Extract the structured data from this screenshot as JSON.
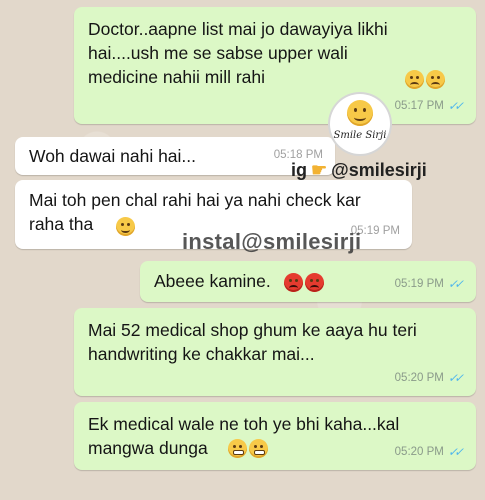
{
  "messages": [
    {
      "direction": "outgoing",
      "text": "Doctor..aapne list mai jo dawayiya likhi hai....ush me se sabse upper wali medicine nahii mill rahi",
      "emojis": [
        "sad-face-emoji",
        "sad-face-emoji"
      ],
      "time": "05:17 PM"
    },
    {
      "direction": "incoming",
      "text": "Woh dawai nahi hai...",
      "emojis": [],
      "time": "05:18 PM"
    },
    {
      "direction": "incoming",
      "text": "Mai toh pen chal rahi hai ya nahi check kar raha tha",
      "emojis": [
        "smiling-face-emoji"
      ],
      "time": "05:19 PM"
    },
    {
      "direction": "outgoing",
      "text": "Abeee kamine.",
      "emojis": [
        "angry-face-emoji",
        "angry-face-emoji"
      ],
      "time": "05:19 PM"
    },
    {
      "direction": "outgoing",
      "text": "Mai 52 medical shop ghum ke aaya hu teri handwriting ke chakkar mai...",
      "emojis": [],
      "time": "05:20 PM"
    },
    {
      "direction": "outgoing",
      "text": "Ek medical wale ne toh ye bhi kaha...kal mangwa dunga",
      "emojis": [
        "steam-face-emoji",
        "steam-face-emoji"
      ],
      "time": "05:20 PM"
    }
  ],
  "read_ticks": "✓✓",
  "watermarks": {
    "logo_text": "Smile Sirji",
    "ig_handle": "ig",
    "ig_handle_name": "@smilesirji",
    "instagram": "instal@smilesirji"
  },
  "colors": {
    "outgoing_bubble": "#dcf8c6",
    "incoming_bubble": "#ffffff",
    "read_ticks": "#4fb6ec",
    "wallpaper": "#e2d8cb"
  }
}
